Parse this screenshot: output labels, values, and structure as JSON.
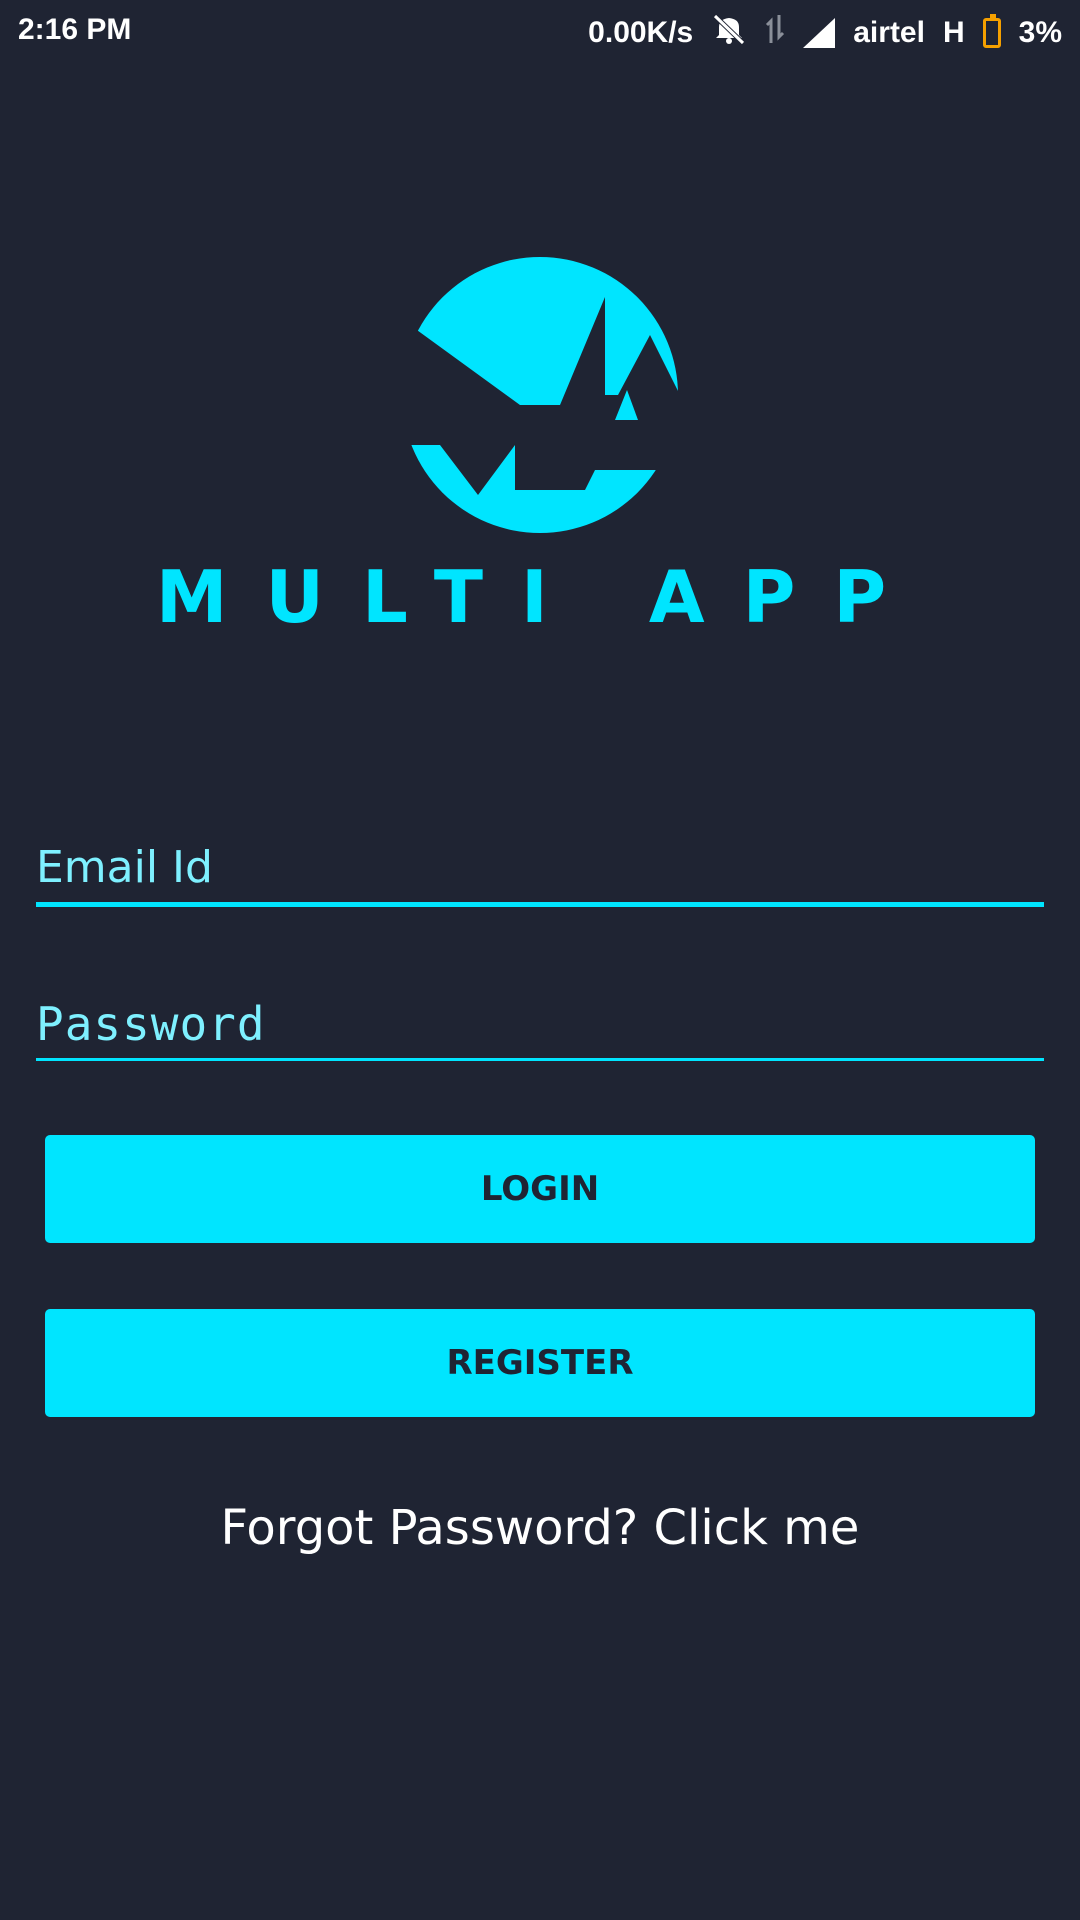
{
  "status_bar": {
    "time": "2:16 PM",
    "network_speed": "0.00K/s",
    "carrier": "airtel",
    "network_type": "H",
    "battery": "3%",
    "icons": [
      "mute-icon",
      "data-transfer-icon",
      "signal-icon",
      "battery-icon"
    ]
  },
  "logo": {
    "text": "MULTI APP",
    "color": "#00e5ff"
  },
  "form": {
    "email_placeholder": "Email Id",
    "password_placeholder": "Password",
    "login_label": "LOGIN",
    "register_label": "REGISTER",
    "forgot_text": "Forgot Password? Click me"
  },
  "colors": {
    "background": "#1f2433",
    "accent": "#00e5ff"
  }
}
